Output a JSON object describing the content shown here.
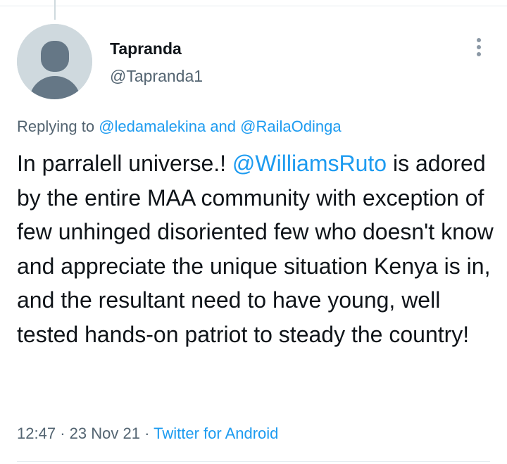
{
  "tweet": {
    "author": {
      "name": "Tapranda",
      "handle": "@Tapranda1"
    },
    "replying": {
      "prefix": "Replying to",
      "mention1": "@ledamalekina",
      "conjunction": "and",
      "mention2": "@RailaOdinga"
    },
    "text": {
      "before_mention": "In parralell universe.! ",
      "mention": "@WilliamsRuto",
      "after_mention": " is adored by the entire MAA community with exception of few unhinged disoriented few who doesn't know and appreciate the unique situation Kenya is in, and the resultant need to have young, well tested hands-on patriot to steady the country!"
    },
    "meta": {
      "time": "12:47",
      "separator": "·",
      "date": "23 Nov 21",
      "source": "Twitter for Android"
    }
  },
  "colors": {
    "link": "#1d9bf0",
    "secondary_text": "#536471",
    "primary_text": "#0f1419",
    "avatar_bg": "#cfd9de",
    "avatar_figure": "#657786"
  },
  "icons": {
    "more": "more-vertical-icon",
    "avatar": "default-avatar-icon"
  }
}
